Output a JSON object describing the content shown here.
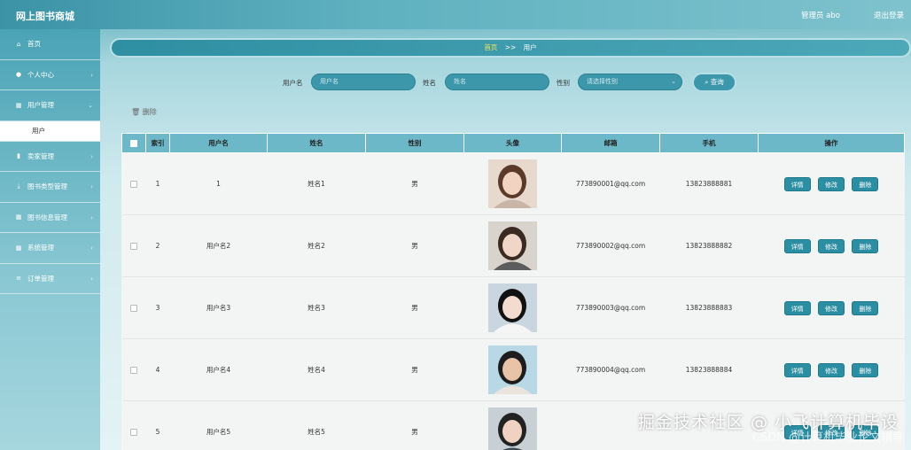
{
  "app": {
    "title": "网上图书商城",
    "user": "管理员 abo",
    "logout": "退出登录"
  },
  "sidebar": {
    "items": [
      {
        "icon": "home-icon",
        "glyph": "⌂",
        "label": "首页",
        "chevron": false
      },
      {
        "icon": "user-icon",
        "glyph": "●",
        "label": "个人中心",
        "chevron": true
      },
      {
        "icon": "grid-icon",
        "glyph": "▦",
        "label": "用户管理",
        "chevron": true
      },
      {
        "icon": "bar-chart-icon",
        "glyph": "▮",
        "label": "卖家管理",
        "chevron": true
      },
      {
        "icon": "download-icon",
        "glyph": "⤓",
        "label": "图书类型管理",
        "chevron": true
      },
      {
        "icon": "grid-icon",
        "glyph": "▦",
        "label": "图书信息管理",
        "chevron": true
      },
      {
        "icon": "grid-icon",
        "glyph": "▦",
        "label": "系统管理",
        "chevron": true
      },
      {
        "icon": "list-icon",
        "glyph": "≡",
        "label": "订单管理",
        "chevron": true
      }
    ],
    "submenu_label": "用户"
  },
  "breadcrumb": {
    "home": "首页",
    "sep": ">>",
    "current": "用户"
  },
  "search": {
    "username_label": "用户名",
    "username_placeholder": "用户名",
    "name_label": "姓名",
    "name_placeholder": "姓名",
    "gender_label": "性别",
    "gender_placeholder": "请选择性别",
    "query_button": "查询"
  },
  "toolbar": {
    "delete_label": "删除"
  },
  "table": {
    "headers": [
      "索引",
      "用户名",
      "姓名",
      "性别",
      "头像",
      "邮箱",
      "手机",
      "操作"
    ],
    "rows": [
      {
        "index": "1",
        "username": "1",
        "name": "姓名1",
        "gender": "男",
        "email": "773890001@qq.com",
        "phone": "13823888881"
      },
      {
        "index": "2",
        "username": "用户名2",
        "name": "姓名2",
        "gender": "男",
        "email": "773890002@qq.com",
        "phone": "13823888882"
      },
      {
        "index": "3",
        "username": "用户名3",
        "name": "姓名3",
        "gender": "男",
        "email": "773890003@qq.com",
        "phone": "13823888883"
      },
      {
        "index": "4",
        "username": "用户名4",
        "name": "姓名4",
        "gender": "男",
        "email": "773890004@qq.com",
        "phone": "13823888884"
      },
      {
        "index": "5",
        "username": "用户名5",
        "name": "姓名5",
        "gender": "男",
        "email": "",
        "phone": ""
      }
    ],
    "actions": {
      "detail": "详情",
      "edit": "修改",
      "delete": "删除"
    }
  },
  "watermark": {
    "line1": "掘金技术社区 @ 小飞计算机毕设",
    "line2": "CSDN @计算机毕业论文辅导"
  },
  "colors": {
    "accent": "#2b8ea3",
    "header": "#6cb8c8",
    "breadcrumb_home": "#f2e85a"
  }
}
